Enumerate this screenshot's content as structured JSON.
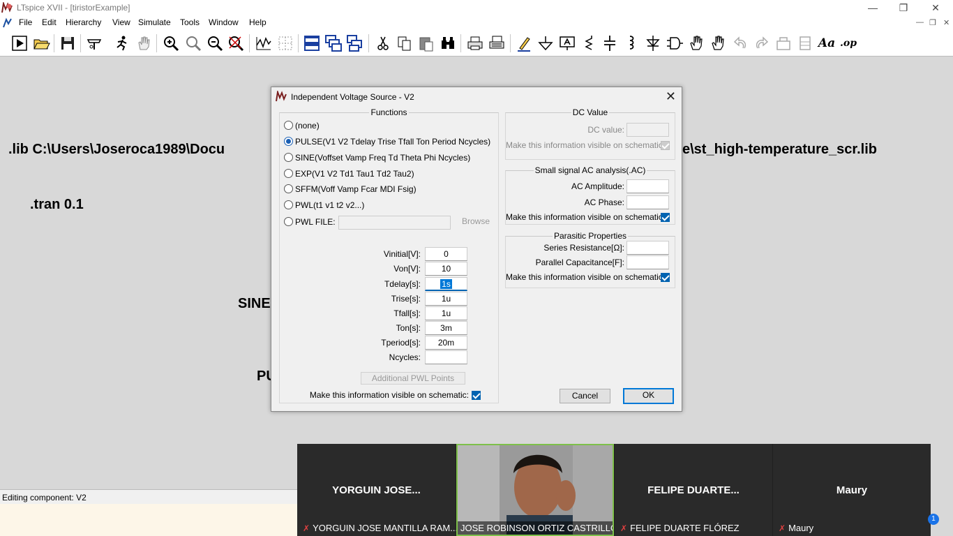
{
  "window": {
    "title": "LTspice XVII - [tiristorExample]",
    "minimize": "—",
    "maximize": "❐",
    "close": "✕"
  },
  "menu": {
    "items": [
      "File",
      "Edit",
      "Hierarchy",
      "View",
      "Simulate",
      "Tools",
      "Window",
      "Help"
    ],
    "mdi_min": "—",
    "mdi_restore": "❐",
    "mdi_close": "✕"
  },
  "toolbar": {
    "icons": [
      "run-icon",
      "open-icon",
      "save-icon",
      "control-panel-icon",
      "halt-icon",
      "pan-hand-icon",
      "zoom-in-icon",
      "zoom-fit-icon",
      "zoom-out-icon",
      "zoom-cancel-icon",
      "waveform-icon",
      "grid-icon",
      "tile-horizontal-icon",
      "cascade-icon",
      "tile-vertical-icon",
      "cut-icon",
      "copy-icon",
      "paste-icon",
      "find-icon",
      "print-icon",
      "print-setup-icon",
      "draw-wire-icon",
      "ground-icon",
      "label-net-icon",
      "resistor-icon",
      "capacitor-icon",
      "inductor-icon",
      "diode-icon",
      "component-icon",
      "move-icon",
      "drag-icon",
      "undo-icon",
      "redo-icon",
      "rotate-icon",
      "mirror-icon",
      "text-icon",
      "spice-directive-icon"
    ],
    "text_label": "Aa",
    "op_label": ".op"
  },
  "schematic": {
    "lib_left": ".lib C:\\Users\\Joseroca1989\\Docu",
    "lib_right": "e\\st_high-temperature_scr.lib",
    "tran": ".tran 0.1",
    "sine_fragment": "SINE",
    "pulse_fragment": "PU"
  },
  "status": {
    "text": "Editing component: V2"
  },
  "dialog": {
    "title": "Independent Voltage Source - V2",
    "functions": {
      "title": "Functions",
      "options": [
        {
          "label": "(none)",
          "checked": false
        },
        {
          "label": "PULSE(V1 V2 Tdelay Trise Tfall Ton Period Ncycles)",
          "checked": true
        },
        {
          "label": "SINE(Voffset Vamp Freq Td Theta Phi Ncycles)",
          "checked": false
        },
        {
          "label": "EXP(V1 V2 Td1 Tau1 Td2 Tau2)",
          "checked": false
        },
        {
          "label": "SFFM(Voff Vamp Fcar MDI Fsig)",
          "checked": false
        },
        {
          "label": "PWL(t1 v1 t2 v2...)",
          "checked": false
        },
        {
          "label": "PWL FILE:",
          "checked": false
        }
      ],
      "browse": "Browse",
      "params": [
        {
          "label": "Vinitial[V]:",
          "value": "0"
        },
        {
          "label": "Von[V]:",
          "value": "10"
        },
        {
          "label": "Tdelay[s]:",
          "value": "1s"
        },
        {
          "label": "Trise[s]:",
          "value": "1u"
        },
        {
          "label": "Tfall[s]:",
          "value": "1u"
        },
        {
          "label": "Ton[s]:",
          "value": "3m"
        },
        {
          "label": "Tperiod[s]:",
          "value": "20m"
        },
        {
          "label": "Ncycles:",
          "value": ""
        }
      ],
      "additional_pwl": "Additional PWL Points",
      "visible_label": "Make this information visible on schematic:"
    },
    "dc": {
      "title": "DC Value",
      "dc_label": "DC value:",
      "visible_label": "Make this information visible on schematic:"
    },
    "ac": {
      "title": "Small signal AC analysis(.AC)",
      "amp_label": "AC Amplitude:",
      "phase_label": "AC Phase:",
      "visible_label": "Make this information visible on schematic:"
    },
    "parasitic": {
      "title": "Parasitic Properties",
      "rser_label": "Series Resistance[Ω]:",
      "cpar_label": "Parallel Capacitance[F]:",
      "visible_label": "Make this information visible on schematic:"
    },
    "cancel": "Cancel",
    "ok": "OK",
    "close": "✕"
  },
  "video": {
    "tiles": [
      {
        "name": "YORGUIN JOSE...",
        "label": "YORGUIN JOSE MANTILLA RAM..."
      },
      {
        "name": "",
        "label": "JOSE ROBINSON ORTIZ CASTRILLON"
      },
      {
        "name": "FELIPE DUARTE...",
        "label": "FELIPE DUARTE FLÓREZ"
      },
      {
        "name": "Maury",
        "label": "Maury"
      }
    ],
    "badge": "1"
  }
}
